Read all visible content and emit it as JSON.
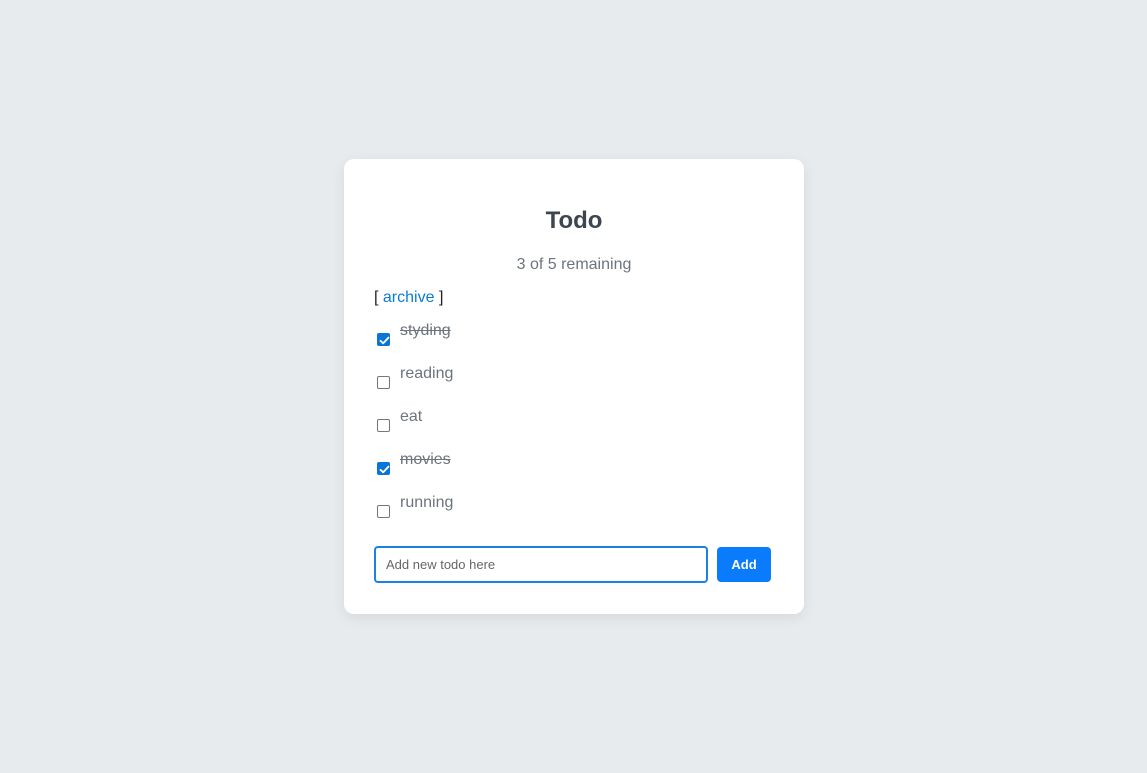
{
  "title": "Todo",
  "remaining_text": "3 of 5 remaining",
  "archive": {
    "open_bracket": "[",
    "link_label": "archive",
    "close_bracket": "]"
  },
  "todos": [
    {
      "text": "styding",
      "done": true
    },
    {
      "text": "reading",
      "done": false
    },
    {
      "text": "eat",
      "done": false
    },
    {
      "text": "movies",
      "done": true
    },
    {
      "text": "running",
      "done": false
    }
  ],
  "new_todo": {
    "value": "",
    "placeholder": "Add new todo here"
  },
  "add_button_label": "Add",
  "colors": {
    "background": "#e8ebee",
    "accent": "#0a7bfa",
    "checked": "#0a75d9",
    "link": "#0a7cd8"
  }
}
